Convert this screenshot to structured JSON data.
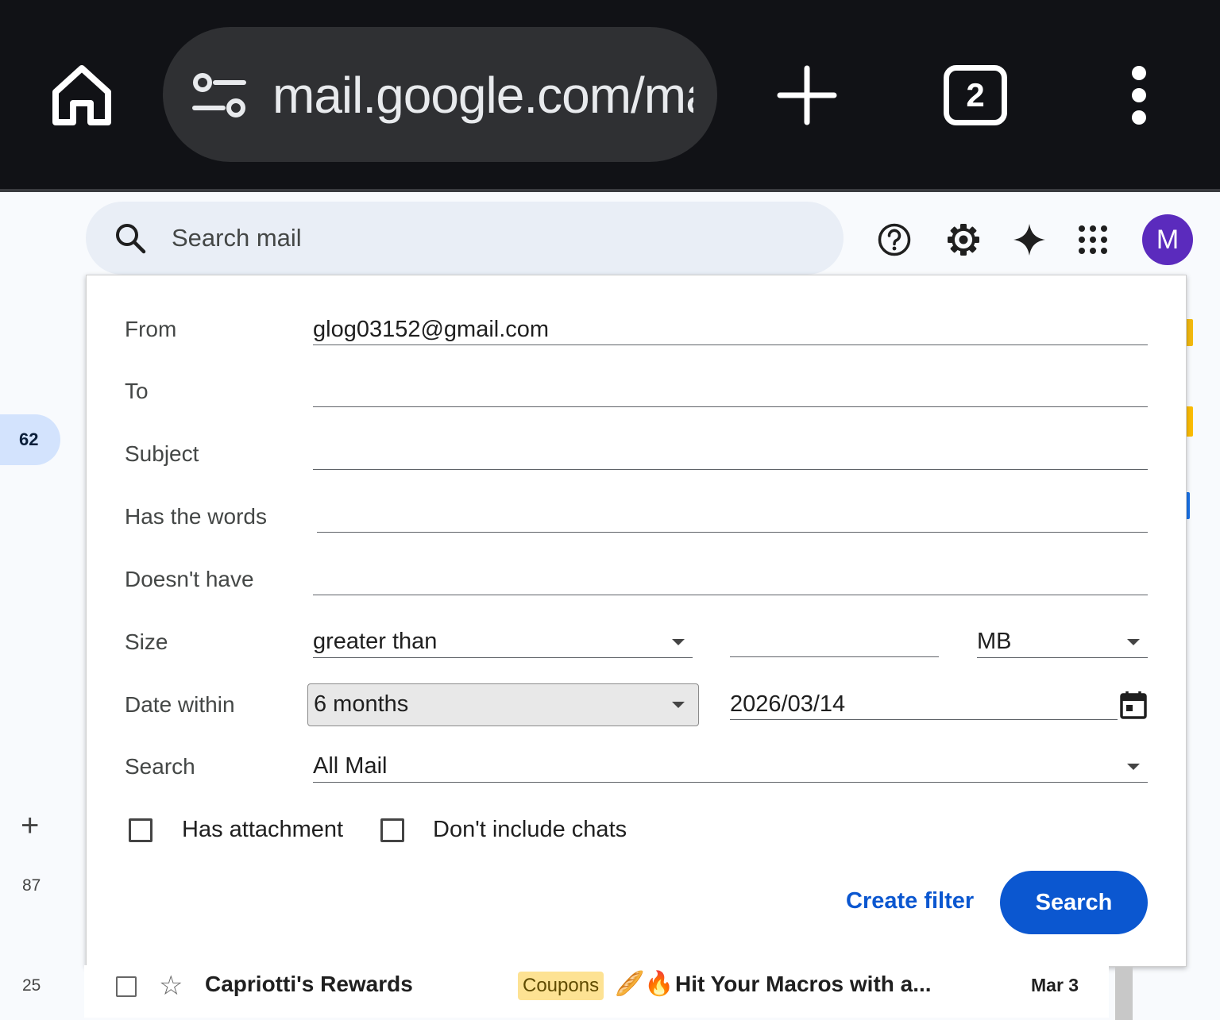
{
  "browser": {
    "url": "mail.google.com/mail",
    "tab_count": "2"
  },
  "header": {
    "search_placeholder": "Search mail",
    "avatar_initial": "M"
  },
  "rail": {
    "inbox_count": "62",
    "counts": [
      "87",
      "25"
    ]
  },
  "advanced_search": {
    "from_label": "From",
    "from_value": "glog03152@gmail.com",
    "to_label": "To",
    "to_value": "",
    "subject_label": "Subject",
    "subject_value": "",
    "has_words_label": "Has the words",
    "has_words_value": "",
    "doesnt_have_label": "Doesn't have",
    "doesnt_have_value": "",
    "size_label": "Size",
    "size_operator": "greater than",
    "size_value": "",
    "size_unit": "MB",
    "date_within_label": "Date within",
    "date_within_value": "6 months",
    "date_value": "2026/03/14",
    "search_label": "Search",
    "search_scope": "All Mail",
    "has_attachment_label": "Has attachment",
    "has_attachment_checked": false,
    "no_chats_label": "Don't include chats",
    "no_chats_checked": false,
    "create_filter_label": "Create filter",
    "search_button_label": "Search"
  },
  "email_row": {
    "sender": "Capriotti's Rewards",
    "tag": "Coupons",
    "emoji": "🥖🔥",
    "subject": "Hit Your Macros with a...",
    "date": "Mar 3"
  },
  "colors": {
    "primary": "#0b57d0",
    "avatar": "#5b2bbd",
    "browser_bar": "#111216"
  }
}
